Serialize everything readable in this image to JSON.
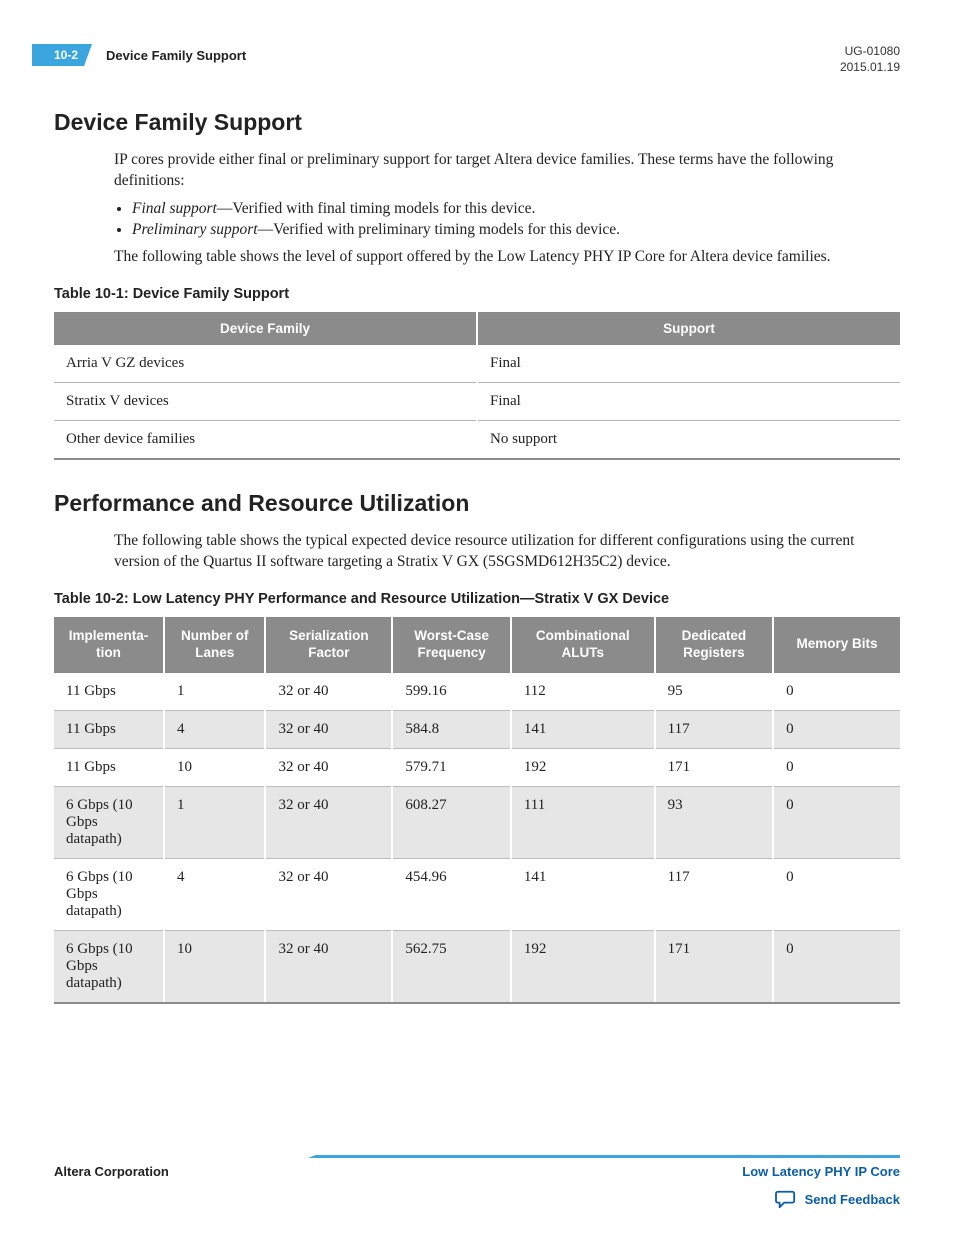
{
  "header": {
    "page_num": "10-2",
    "section_name": "Device Family Support",
    "doc_code": "UG-01080",
    "date": "2015.01.19"
  },
  "section1": {
    "title": "Device Family Support",
    "intro": "IP cores provide either final or preliminary support for target Altera device families. These terms have the following definitions:",
    "bullets": [
      {
        "term": "Final support",
        "desc": "—Verified with final timing models for this device."
      },
      {
        "term": "Preliminary support",
        "desc": "—Verified with preliminary timing models for this device."
      }
    ],
    "post_list": "The following table shows the level of support offered by the Low Latency PHY IP Core for Altera device families.",
    "table_caption": "Table 10-1: Device Family Support",
    "table": {
      "headers": [
        "Device Family",
        "Support"
      ],
      "rows": [
        [
          "Arria V GZ devices",
          "Final"
        ],
        [
          "Stratix V devices",
          "Final"
        ],
        [
          "Other device families",
          "No support"
        ]
      ]
    }
  },
  "section2": {
    "title": "Performance and Resource Utilization",
    "intro": "The following table shows the typical expected device resource utilization for different configurations using the current version of the Quartus II software targeting a Stratix V GX (5SGSMD612H35C2) device.",
    "table_caption": "Table 10-2: Low Latency PHY Performance and Resource Utilization—Stratix V GX Device",
    "table": {
      "headers": [
        "Implementa­tion",
        "Number of Lanes",
        "Serialization Factor",
        "Worst-Case Frequency",
        "Combinational ALUTs",
        "Dedicated Registers",
        "Memory Bits"
      ],
      "rows": [
        [
          "11 Gbps",
          "1",
          "32 or 40",
          "599.16",
          "112",
          "95",
          "0"
        ],
        [
          "11 Gbps",
          "4",
          "32 or 40",
          "584.8",
          "141",
          "117",
          "0"
        ],
        [
          "11 Gbps",
          "10",
          "32 or 40",
          "579.71",
          "192",
          "171",
          "0"
        ],
        [
          "6 Gbps (10 Gbps datapath)",
          "1",
          "32 or 40",
          "608.27",
          "111",
          "93",
          "0"
        ],
        [
          "6 Gbps (10 Gbps datapath)",
          "4",
          "32 or 40",
          "454.96",
          "141",
          "117",
          "0"
        ],
        [
          "6 Gbps (10 Gbps datapath)",
          "10",
          "32 or 40",
          "562.75",
          "192",
          "171",
          "0"
        ]
      ]
    }
  },
  "footer": {
    "left": "Altera Corporation",
    "right": "Low Latency PHY IP Core",
    "feedback": "Send Feedback"
  }
}
